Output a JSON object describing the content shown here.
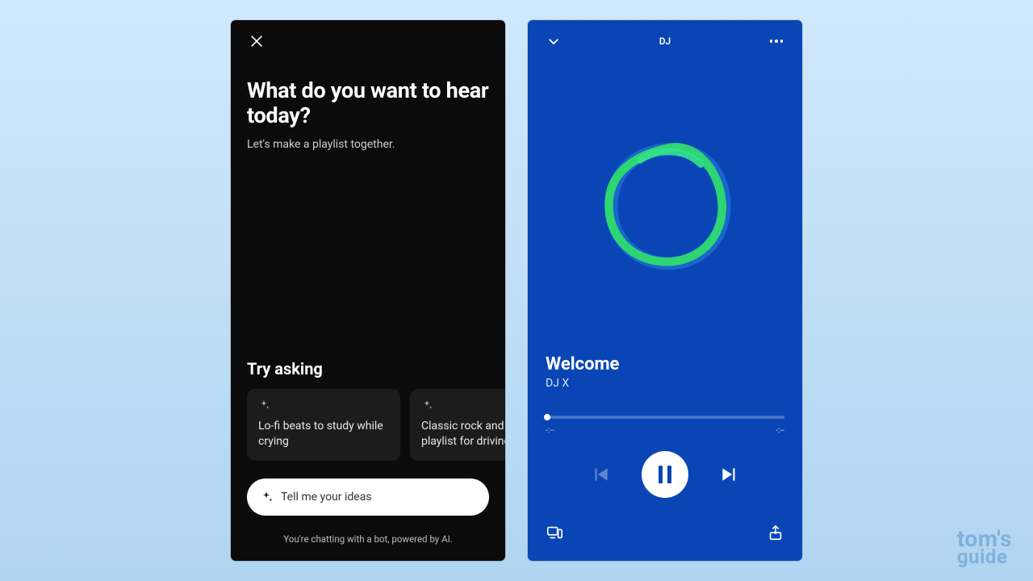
{
  "left": {
    "title": "What do you want to hear today?",
    "subtitle": "Let's make a playlist together.",
    "try_heading": "Try asking",
    "suggestions": [
      "Lo-fi beats to study while crying",
      "Classic rock and metal playlist for driving"
    ],
    "input_placeholder": "Tell me your ideas",
    "disclaimer": "You're chatting with a bot, powered by AI."
  },
  "right": {
    "header_title": "DJ",
    "track_title": "Welcome",
    "artist": "DJ X",
    "time_elapsed": "-:--",
    "time_remaining": "-:--"
  },
  "watermark": {
    "line1": "tom's",
    "line2": "guide"
  },
  "colors": {
    "left_bg": "#0b0b0b",
    "right_bg": "#0a45b5",
    "orb_green": "#2ed573",
    "orb_blue": "#1d6fd1"
  }
}
